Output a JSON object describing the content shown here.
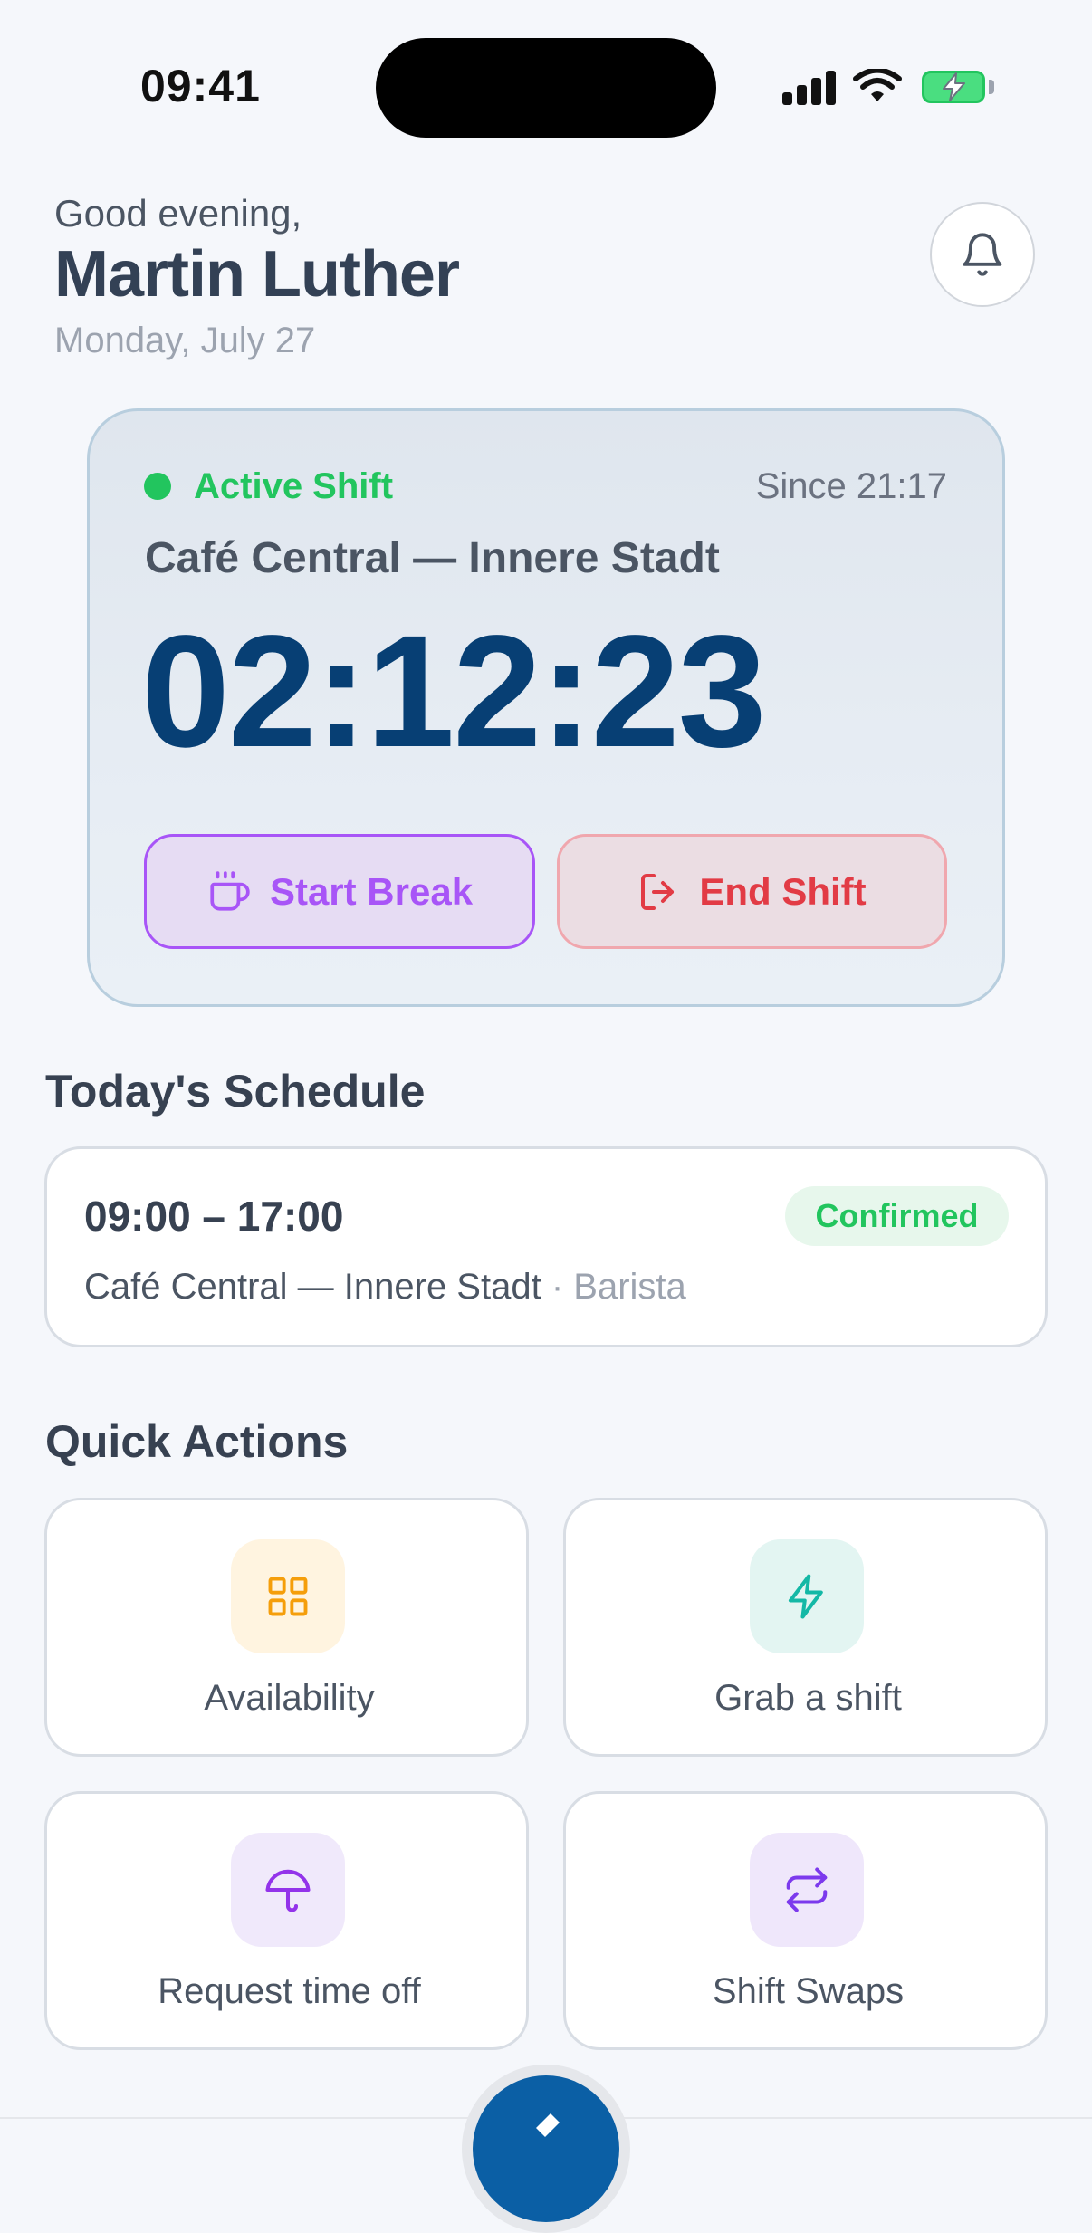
{
  "status_bar": {
    "time": "09:41"
  },
  "header": {
    "greeting": "Good evening,",
    "name": "Martin Luther",
    "date": "Monday, July 27",
    "bell_icon": "bell-icon"
  },
  "active_shift": {
    "status_label": "Active Shift",
    "since": "Since 21:17",
    "location": "Café Central — Innere Stadt",
    "elapsed": "02:12:23",
    "break_button": "Start Break",
    "end_button": "End Shift",
    "colors": {
      "active": "#22c55e",
      "timer": "#073f74",
      "break": "#a855f7",
      "end": "#e23b45"
    }
  },
  "schedule": {
    "title": "Today's Schedule",
    "time_range": "09:00 – 17:00",
    "status": "Confirmed",
    "location": "Café Central — Innere Stadt",
    "separator": " · ",
    "role": "Barista"
  },
  "quick_actions": {
    "title": "Quick Actions",
    "items": [
      {
        "label": "Availability",
        "icon": "grid-icon",
        "tint": "#fff4e0",
        "color": "#f59e0b"
      },
      {
        "label": "Grab a shift",
        "icon": "lightning-icon",
        "tint": "#e3f5f2",
        "color": "#14b8a6"
      },
      {
        "label": "Request time off",
        "icon": "umbrella-icon",
        "tint": "#f0e9fb",
        "color": "#9333ea"
      },
      {
        "label": "Shift Swaps",
        "icon": "swap-icon",
        "tint": "#efe7fb",
        "color": "#7c3aed"
      }
    ]
  }
}
